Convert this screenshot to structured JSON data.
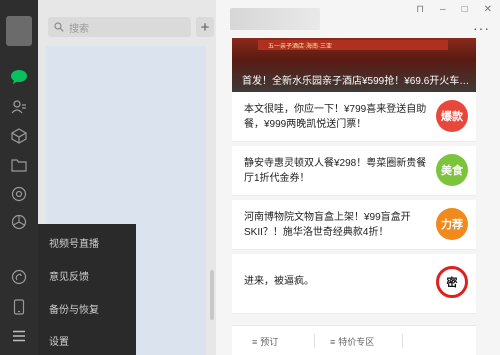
{
  "search": {
    "placeholder": "搜索",
    "add_label": "+"
  },
  "menu": {
    "items": [
      {
        "label": "视频号直播"
      },
      {
        "label": "意见反馈"
      },
      {
        "label": "备份与恢复"
      },
      {
        "label": "设置"
      }
    ]
  },
  "titlebar": {
    "pin": "⊓",
    "minimize": "–",
    "maximize": "□",
    "close": "✕",
    "more": "···"
  },
  "article": {
    "banner_strip": "五一亲子酒店·海南·三亚",
    "banner_caption": "首发！全新水乐园亲子酒店¥599抢！¥69.6开火车…",
    "items": [
      {
        "text": "本文很哇，你应一下！¥799喜来登送自助餐，¥999两晚凯悦送门票！",
        "badge": "爆款",
        "badge_color": "#e8473b"
      },
      {
        "text": "静安寺惠灵顿双人餐¥298！粤菜圈新贵餐厅1折代金券！",
        "badge": "美食",
        "badge_color": "#7cc43c"
      },
      {
        "text": "河南博物院文物盲盒上架！¥99盲盒开SKII？！施华洛世奇经典款4折！",
        "badge": "力荐",
        "badge_color": "#f08a1c"
      },
      {
        "text": "进来，被逼疯。",
        "badge": "密",
        "badge_color": "#ffffff"
      }
    ]
  },
  "bottom": {
    "btn1": "预订",
    "btn2": "特价专区"
  },
  "colors": {
    "rail": "#2e2e2e",
    "accent": "#07c160",
    "menu_bg": "#2a2a2a"
  }
}
